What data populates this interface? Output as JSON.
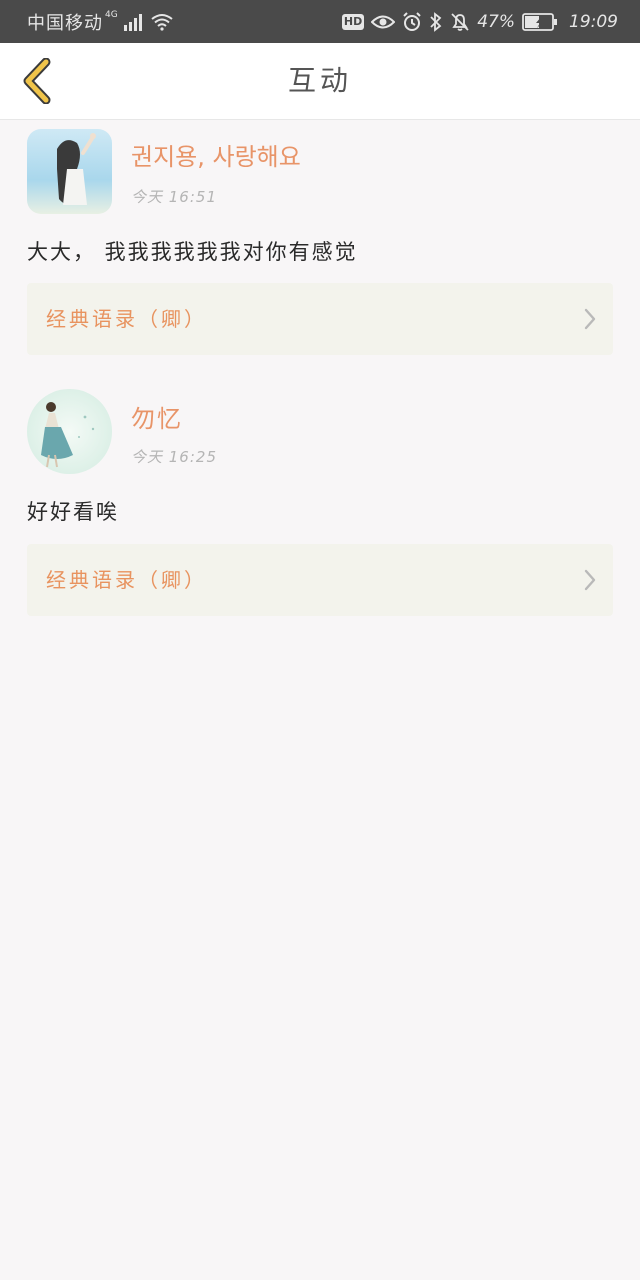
{
  "status_bar": {
    "carrier": "中国移动",
    "network": "4G",
    "hd": "HD",
    "battery": "47%",
    "time": "19:09"
  },
  "nav": {
    "title": "互动"
  },
  "posts": [
    {
      "username": "권지용, 사랑해요",
      "time": "今天 16:51",
      "content": "大大， 我我我我我我对你有感觉",
      "ref_label": "经典语录（卿）"
    },
    {
      "username": "勿忆",
      "time": "今天 16:25",
      "content": "好好看唉",
      "ref_label": "经典语录（卿）"
    }
  ],
  "colors": {
    "accent_orange": "#e8935f",
    "back_arrow": "#f0c44a",
    "card_bg": "#f3f3ec"
  }
}
